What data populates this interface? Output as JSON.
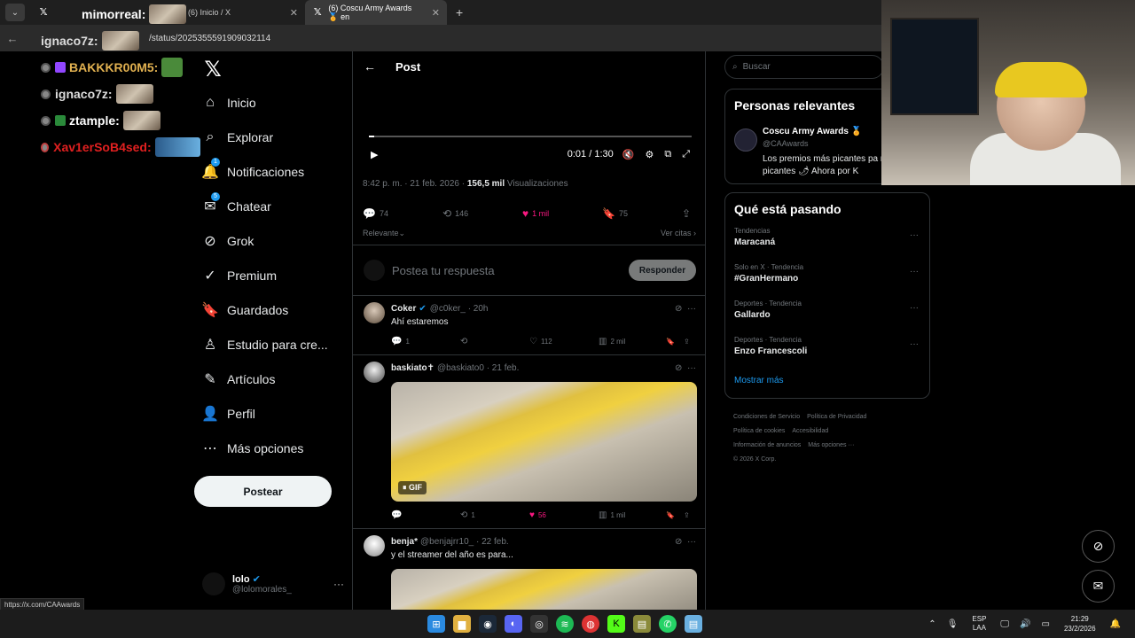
{
  "browser": {
    "tabs": [
      {
        "title": "(6) Inicio / X"
      },
      {
        "title": "(6) Coscu Army Awards 🏅 en"
      }
    ],
    "url": "/status/2025355591909032114",
    "status_url": "https://x.com/CAAwards"
  },
  "chat": [
    {
      "user": "mimorreal:",
      "color": "#ffffff"
    },
    {
      "user": "ignaco7z:",
      "color": "#dddddd"
    },
    {
      "user": "BAKKKR00M5:",
      "color": "#e0b050"
    },
    {
      "user": "ignaco7z:",
      "color": "#dddddd"
    },
    {
      "user": "ztample:",
      "color": "#ffffff"
    },
    {
      "user": "Xav1erSoB4sed:",
      "color": "#e02020"
    }
  ],
  "nav": {
    "items": [
      {
        "label": "Inicio",
        "icon": "⌂"
      },
      {
        "label": "Explorar",
        "icon": "⌕"
      },
      {
        "label": "Notificaciones",
        "icon": "🔔",
        "badge": "1"
      },
      {
        "label": "Chatear",
        "icon": "✉",
        "badge": "5"
      },
      {
        "label": "Grok",
        "icon": "⊘"
      },
      {
        "label": "Premium",
        "icon": "✓"
      },
      {
        "label": "Guardados",
        "icon": "🔖"
      },
      {
        "label": "Estudio para cre...",
        "icon": "♙"
      },
      {
        "label": "Artículos",
        "icon": "✎"
      },
      {
        "label": "Perfil",
        "icon": "👤"
      },
      {
        "label": "Más opciones",
        "icon": "⋯"
      }
    ],
    "post_button": "Postear",
    "account": {
      "name": "lolo",
      "handle": "@lolomorales_"
    }
  },
  "post": {
    "header": "Post",
    "video_time": "0:01 / 1:30",
    "meta_time": "8:42 p. m. · 21 feb. 2026 ·",
    "views_count": "156,5 mil",
    "views_label": "Visualizaciones",
    "stats": {
      "replies": "74",
      "reposts": "146",
      "likes": "1 mil",
      "bookmarks": "75"
    },
    "sort": "Relevante",
    "view_quotes": "Ver citas",
    "reply_placeholder": "Postea tu respuesta",
    "reply_button": "Responder"
  },
  "replies": [
    {
      "name": "Coker",
      "handle": "@c0ker_ · 20h",
      "text": "Ahí estaremos",
      "replies": "1",
      "reposts": "",
      "likes": "112",
      "views": "2 mil"
    },
    {
      "name": "baskiato✝",
      "handle": "@baskiato0 · 21 feb.",
      "text": "",
      "gif": "GIF",
      "replies": "",
      "reposts": "1",
      "likes": "56",
      "views": "1 mil"
    },
    {
      "name": "benja*",
      "handle": "@benjajrr10_ · 22 feb.",
      "text": "y el streamer del año es para..."
    }
  ],
  "right": {
    "search_placeholder": "Buscar",
    "relevant_title": "Personas relevantes",
    "relevant": {
      "name": "Coscu Army Awards 🏅",
      "handle": "@CAAwards",
      "bio": "Los premios más picantes pa más picantes 🌶 Ahora por K"
    },
    "trends_title": "Qué está pasando",
    "trends": [
      {
        "category": "Tendencias",
        "name": "Maracaná"
      },
      {
        "category": "Solo en X · Tendencia",
        "name": "#GranHermano"
      },
      {
        "category": "Deportes · Tendencia",
        "name": "Gallardo"
      },
      {
        "category": "Deportes · Tendencia",
        "name": "Enzo Francescoli"
      }
    ],
    "show_more": "Mostrar más",
    "footer": [
      "Condiciones de Servicio",
      "Política de Privacidad",
      "Política de cookies",
      "Accesibilidad",
      "Información de anuncios",
      "Más opciones ···",
      "© 2026 X Corp."
    ]
  },
  "taskbar": {
    "lang": "ESP",
    "lang2": "LAA",
    "time": "21:29",
    "date": "23/2/2026"
  },
  "colors": {
    "accent": "#1d9bf0",
    "like": "#f91880",
    "bg": "#000000"
  }
}
